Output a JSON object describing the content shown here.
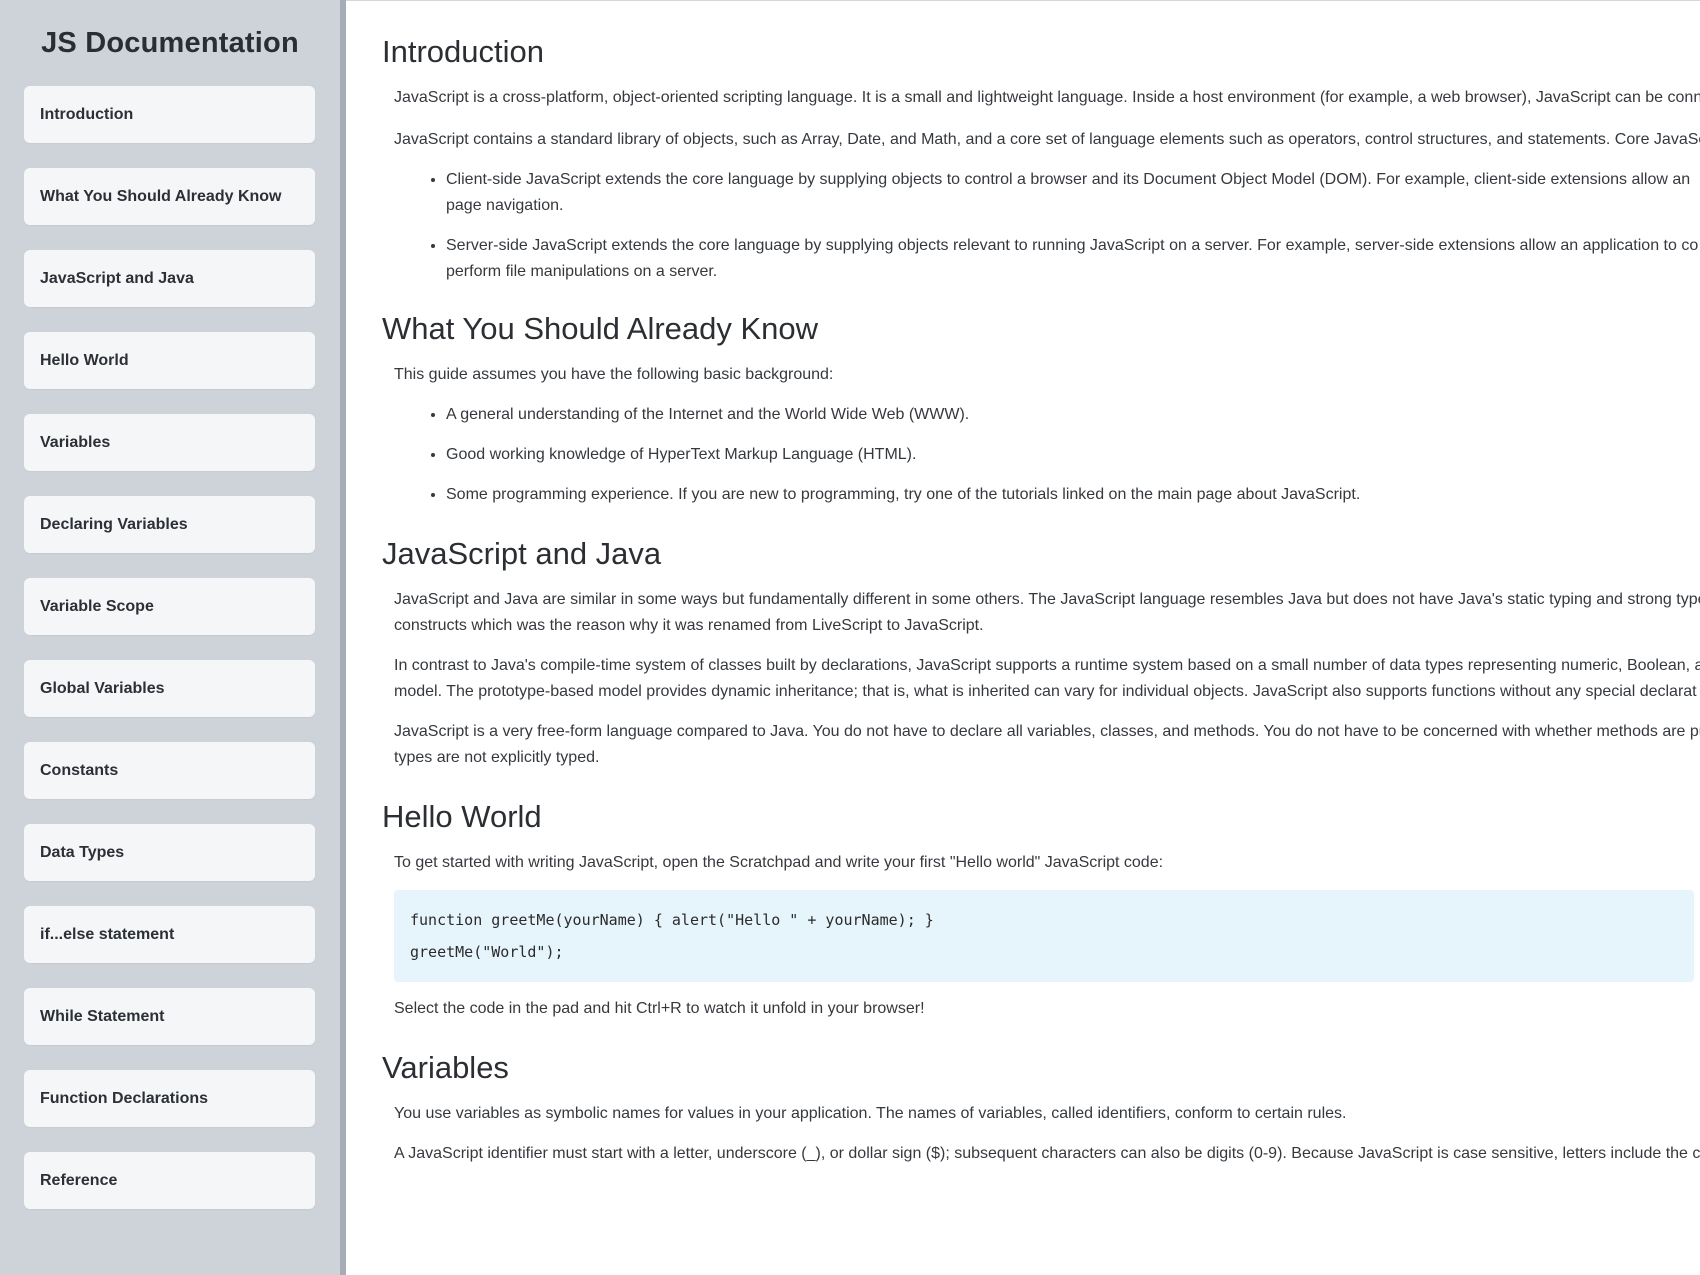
{
  "navbar": {
    "title": "JS Documentation",
    "items": [
      {
        "label": "Introduction"
      },
      {
        "label": "What You Should Already Know"
      },
      {
        "label": "JavaScript and Java"
      },
      {
        "label": "Hello World"
      },
      {
        "label": "Variables"
      },
      {
        "label": "Declaring Variables"
      },
      {
        "label": "Variable Scope"
      },
      {
        "label": "Global Variables"
      },
      {
        "label": "Constants"
      },
      {
        "label": "Data Types"
      },
      {
        "label": "if...else statement"
      },
      {
        "label": "While Statement"
      },
      {
        "label": "Function Declarations"
      },
      {
        "label": "Reference"
      }
    ]
  },
  "sections": {
    "introduction": {
      "heading": "Introduction",
      "p1": "JavaScript is a cross-platform, object-oriented scripting language. It is a small and lightweight language. Inside a host environment (for example, a web browser), JavaScript can be conn",
      "p2": "JavaScript contains a standard library of objects, such as Array, Date, and Math, and a core set of language elements such as operators, control structures, and statements. Core JavaScr",
      "bullets": [
        "Client-side JavaScript extends the core language by supplying objects to control a browser and its Document Object Model (DOM). For example, client-side extensions allow an",
        "page navigation.",
        "Server-side JavaScript extends the core language by supplying objects relevant to running JavaScript on a server. For example, server-side extensions allow an application to co",
        "perform file manipulations on a server."
      ]
    },
    "know": {
      "heading": "What You Should Already Know",
      "p1": "This guide assumes you have the following basic background:",
      "bullets": [
        "A general understanding of the Internet and the World Wide Web (WWW).",
        "Good working knowledge of HyperText Markup Language (HTML).",
        "Some programming experience. If you are new to programming, try one of the tutorials linked on the main page about JavaScript."
      ]
    },
    "java": {
      "heading": "JavaScript and Java",
      "p1a": "JavaScript and Java are similar in some ways but fundamentally different in some others. The JavaScript language resembles Java but does not have Java's static typing and strong type",
      "p1b": "constructs which was the reason why it was renamed from LiveScript to JavaScript.",
      "p2a": "In contrast to Java's compile-time system of classes built by declarations, JavaScript supports a runtime system based on a small number of data types representing numeric, Boolean, a",
      "p2b": "model. The prototype-based model provides dynamic inheritance; that is, what is inherited can vary for individual objects. JavaScript also supports functions without any special declarat",
      "p3a": "JavaScript is a very free-form language compared to Java. You do not have to declare all variables, classes, and methods. You do not have to be concerned with whether methods are pu",
      "p3b": "types are not explicitly typed."
    },
    "hello": {
      "heading": "Hello World",
      "p1": "To get started with writing JavaScript, open the Scratchpad and write your first \"Hello world\" JavaScript code:",
      "code_line1": "function greetMe(yourName) { alert(\"Hello \" + yourName); }",
      "code_line2": "greetMe(\"World\");",
      "p2": "Select the code in the pad and hit Ctrl+R to watch it unfold in your browser!"
    },
    "variables": {
      "heading": "Variables",
      "p1": "You use variables as symbolic names for values in your application. The names of variables, called identifiers, conform to certain rules.",
      "p2": "A JavaScript identifier must start with a letter, underscore (_), or dollar sign ($); subsequent characters can also be digits (0-9). Because JavaScript is case sensitive, letters include the ch"
    }
  },
  "colors": {
    "sidebar_bg": "#ced3da",
    "sidebar_border": "#a6adb6",
    "nav_item_bg": "#f5f6f8",
    "code_bg": "#e6f4fc"
  }
}
